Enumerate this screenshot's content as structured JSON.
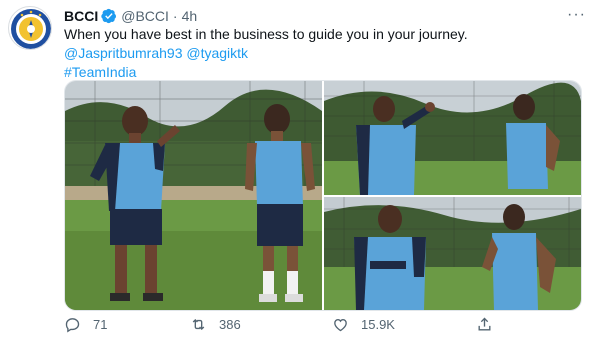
{
  "account": {
    "name": "BCCI",
    "handle": "@BCCI",
    "separator": "·",
    "time": "4h",
    "more": "···"
  },
  "tweet": {
    "text": "When you have best in the business to guide you in your journey.",
    "mentions": "@Jaspritbumrah93 @tyagiktk",
    "hashtag": "#TeamIndia"
  },
  "actions": {
    "replies": "71",
    "retweets": "386",
    "likes": "15.9K"
  },
  "colors": {
    "link": "#1d9bf0",
    "verified": "#1d9bf0",
    "jersey": "#5aa3d8",
    "grass": "#5f8a3a"
  },
  "icons": [
    "verified-icon",
    "more-icon",
    "reply-icon",
    "retweet-icon",
    "like-icon",
    "share-icon"
  ]
}
